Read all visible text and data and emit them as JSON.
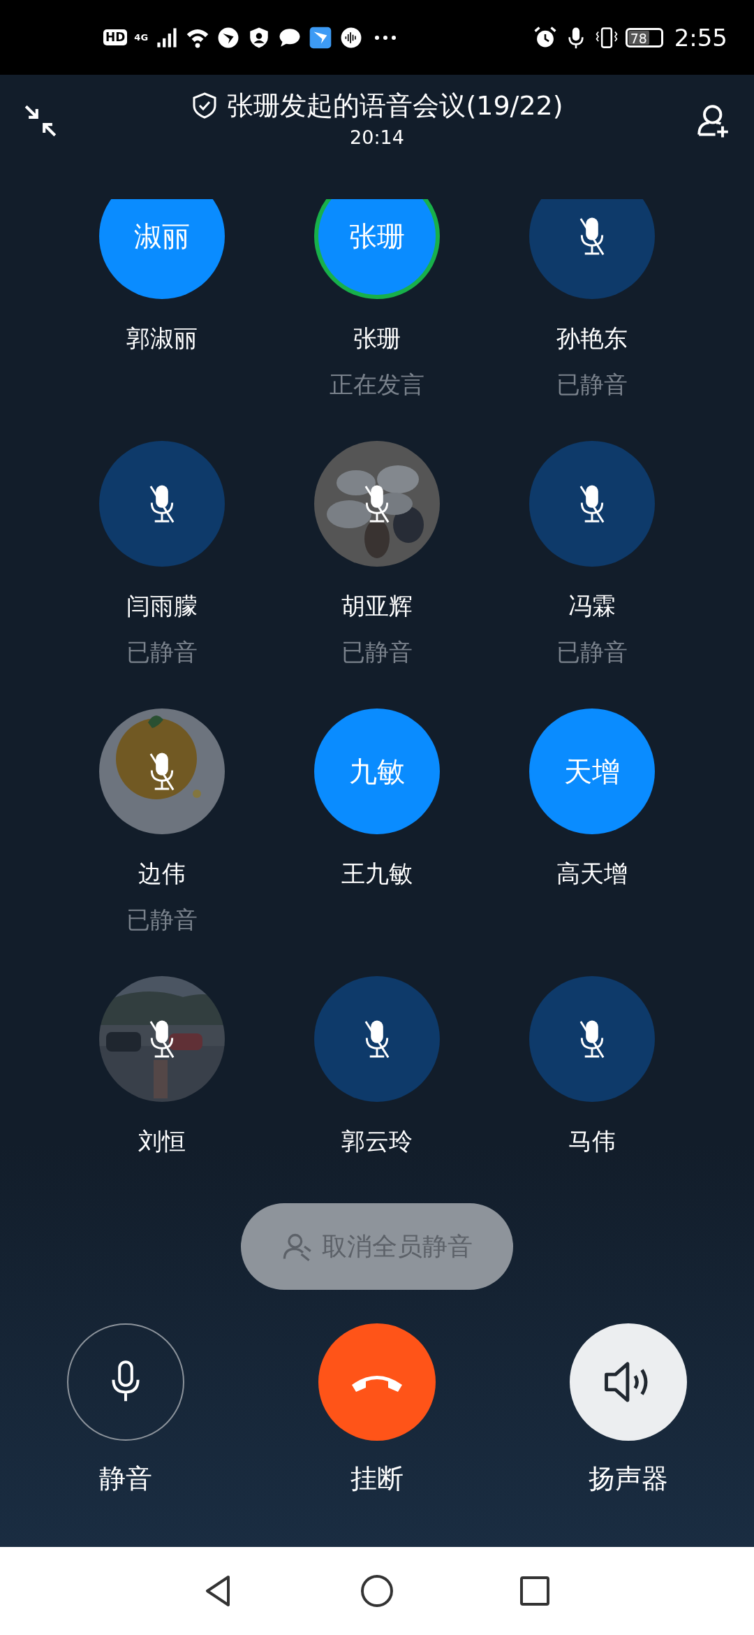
{
  "status_bar": {
    "hd": "HD",
    "network": "4G",
    "battery": "78",
    "time": "2:55"
  },
  "header": {
    "title": "张珊发起的语音会议(19/22)",
    "duration": "20:14"
  },
  "participants": [
    {
      "name": "郭淑丽",
      "avatar": {
        "kind": "initials",
        "text": "淑丽"
      },
      "muted": false,
      "speaking": false
    },
    {
      "name": "张珊",
      "avatar": {
        "kind": "initials",
        "text": "张珊"
      },
      "muted": false,
      "speaking": true,
      "status": "正在发言"
    },
    {
      "name": "孙艳东",
      "avatar": {
        "kind": "initials"
      },
      "muted": true,
      "speaking": false,
      "status": "已静音"
    },
    {
      "name": "闫雨朦",
      "avatar": {
        "kind": "initials"
      },
      "muted": true,
      "speaking": false,
      "status": "已静音"
    },
    {
      "name": "胡亚辉",
      "muted": true,
      "speaking": false,
      "status": "已静音"
    },
    {
      "name": "冯霖",
      "avatar": {
        "kind": "initials"
      },
      "muted": true,
      "speaking": false,
      "status": "已静音"
    },
    {
      "name": "边伟",
      "muted": true,
      "speaking": false,
      "status": "已静音"
    },
    {
      "name": "王九敏",
      "avatar": {
        "kind": "initials",
        "text": "九敏"
      },
      "muted": false,
      "speaking": false
    },
    {
      "name": "高天增",
      "avatar": {
        "kind": "initials",
        "text": "天增"
      },
      "muted": false,
      "speaking": false
    },
    {
      "name": "刘恒",
      "muted": true,
      "speaking": false
    },
    {
      "name": "郭云玲",
      "avatar": {
        "kind": "initials"
      },
      "muted": true,
      "speaking": false
    },
    {
      "name": "马伟",
      "avatar": {
        "kind": "initials"
      },
      "muted": true,
      "speaking": false
    }
  ],
  "unmute_all_button": {
    "label": "取消全员静音",
    "disabled": true
  },
  "controls": [
    {
      "kind": "mute",
      "label": "静音",
      "on": false
    },
    {
      "kind": "hangup",
      "label": "挂断"
    },
    {
      "kind": "speaker",
      "label": "扬声器",
      "on": true
    }
  ]
}
